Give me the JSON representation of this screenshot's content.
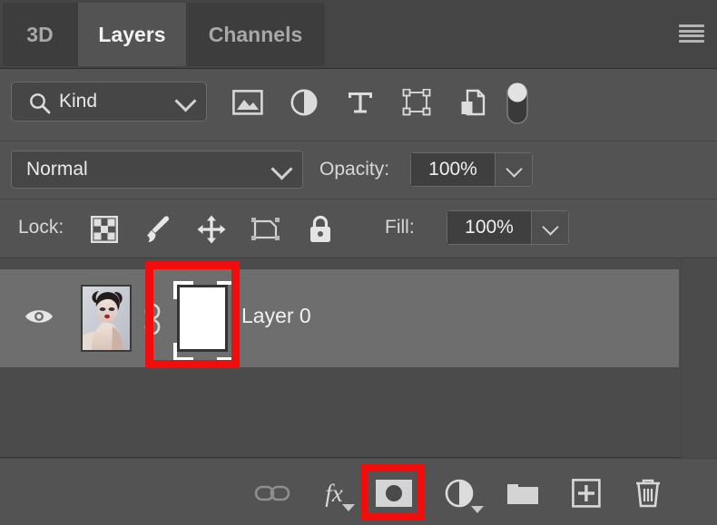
{
  "panel": {
    "title": "Layers",
    "tabs": [
      {
        "label": "3D",
        "active": false
      },
      {
        "label": "Layers",
        "active": true
      },
      {
        "label": "Channels",
        "active": false
      }
    ],
    "menu_icon": "hamburger-menu-icon"
  },
  "filter": {
    "search_icon": "search-icon",
    "kind_label": "Kind",
    "chevron_icon": "chevron-down-icon",
    "type_filters": [
      {
        "name": "filter-pixel-layers",
        "icon": "image-icon"
      },
      {
        "name": "filter-adjustment-layers",
        "icon": "adjustment-half-circle-icon"
      },
      {
        "name": "filter-type-layers",
        "icon": "type-t-icon"
      },
      {
        "name": "filter-shape-layers",
        "icon": "shape-bounding-box-icon"
      },
      {
        "name": "filter-smart-objects",
        "icon": "smart-object-icon"
      }
    ],
    "toggle_icon": "filter-toggle-switch-icon",
    "toggle_state": "on"
  },
  "blend": {
    "mode": "Normal",
    "opacity_label": "Opacity:",
    "opacity_value": "100%",
    "chevron_icon": "chevron-down-icon"
  },
  "lock": {
    "label": "Lock:",
    "items": [
      {
        "name": "lock-transparent-pixels",
        "icon": "checkerboard-icon"
      },
      {
        "name": "lock-image-pixels",
        "icon": "brush-icon"
      },
      {
        "name": "lock-position",
        "icon": "move-arrows-icon"
      },
      {
        "name": "lock-artboard-nesting",
        "icon": "artboard-icon"
      },
      {
        "name": "lock-all",
        "icon": "padlock-icon"
      }
    ],
    "fill_label": "Fill:",
    "fill_value": "100%"
  },
  "layers": [
    {
      "name": "Layer 0",
      "visible": true,
      "selected": true,
      "has_mask": true,
      "mask_linked": true,
      "mask_active": true,
      "thumbnail": "portrait-photo-thumbnail",
      "mask_thumbnail": "white-layer-mask-thumbnail"
    }
  ],
  "bottom_toolbar": [
    {
      "name": "link-layers-button",
      "icon": "link-chain-icon",
      "enabled": false
    },
    {
      "name": "layer-style-button",
      "icon": "fx-icon",
      "label": "fx",
      "has_menu": true
    },
    {
      "name": "add-layer-mask-button",
      "icon": "add-layer-mask-icon",
      "highlighted": true
    },
    {
      "name": "new-fill-adjustment-button",
      "icon": "adjustment-half-circle-icon",
      "has_menu": true
    },
    {
      "name": "new-group-button",
      "icon": "folder-icon"
    },
    {
      "name": "new-layer-button",
      "icon": "plus-square-icon"
    },
    {
      "name": "delete-layer-button",
      "icon": "trash-icon"
    }
  ],
  "annotations": {
    "highlight_color": "#f20d0d",
    "boxes": [
      {
        "name": "layer-mask-thumbnail-highlight",
        "target": "layer-mask-thumbnail"
      },
      {
        "name": "add-layer-mask-button-highlight",
        "target": "add-layer-mask-button"
      }
    ]
  }
}
